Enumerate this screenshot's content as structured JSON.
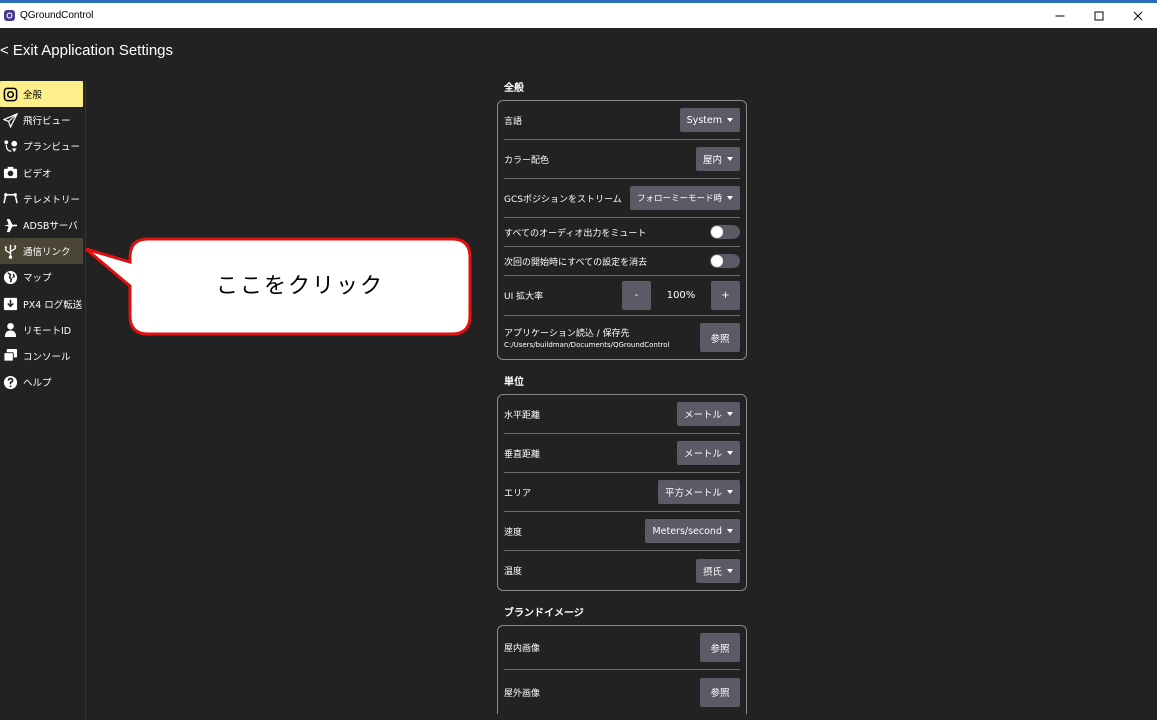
{
  "window": {
    "title": "QGroundControl"
  },
  "header": {
    "back_label": "< Exit Application Settings"
  },
  "sidebar": {
    "items": [
      {
        "label": "全般",
        "icon": "general-icon"
      },
      {
        "label": "飛行ビュー",
        "icon": "paper-plane-icon"
      },
      {
        "label": "プランビュー",
        "icon": "route-icon"
      },
      {
        "label": "ビデオ",
        "icon": "camera-icon"
      },
      {
        "label": "テレメトリー",
        "icon": "telemetry-icon"
      },
      {
        "label": "ADSBサーバ",
        "icon": "airplane-icon"
      },
      {
        "label": "通信リンク",
        "icon": "usb-icon"
      },
      {
        "label": "マップ",
        "icon": "globe-icon"
      },
      {
        "label": "PX4 ログ転送",
        "icon": "download-icon"
      },
      {
        "label": "リモートID",
        "icon": "person-icon"
      },
      {
        "label": "コンソール",
        "icon": "console-icon"
      },
      {
        "label": "ヘルプ",
        "icon": "help-icon"
      }
    ]
  },
  "callout": {
    "text": "ここをクリック",
    "border_color": "#e01010"
  },
  "general": {
    "title": "全般",
    "language": {
      "label": "言語",
      "value": "System"
    },
    "color_scheme": {
      "label": "カラー配色",
      "value": "屋内"
    },
    "gcs_stream": {
      "label": "GCSポジションをストリーム",
      "value": "フォローミーモード時"
    },
    "mute_audio": {
      "label": "すべてのオーディオ出力をミュート"
    },
    "clear_settings": {
      "label": "次回の開始時にすべての設定を消去"
    },
    "ui_scale": {
      "label": "UI 拡大率",
      "minus": "-",
      "value": "100%",
      "plus": "+"
    },
    "app_path": {
      "label": "アプリケーション読込 / 保存先",
      "path": "C:/Users/buildman/Documents/QGroundControl",
      "button": "参照"
    }
  },
  "units": {
    "title": "単位",
    "horizontal": {
      "label": "水平距離",
      "value": "メートル"
    },
    "vertical": {
      "label": "垂直距離",
      "value": "メートル"
    },
    "area": {
      "label": "エリア",
      "value": "平方メートル"
    },
    "speed": {
      "label": "速度",
      "value": "Meters/second"
    },
    "temperature": {
      "label": "温度",
      "value": "摂氏"
    }
  },
  "brand": {
    "title": "ブランドイメージ",
    "indoor": {
      "label": "屋内画像",
      "button": "参照"
    },
    "outdoor": {
      "label": "屋外画像",
      "button": "参照"
    }
  },
  "colors": {
    "active_item": "#fdf08a",
    "button_bg": "#5b5a66",
    "background": "#222222"
  }
}
